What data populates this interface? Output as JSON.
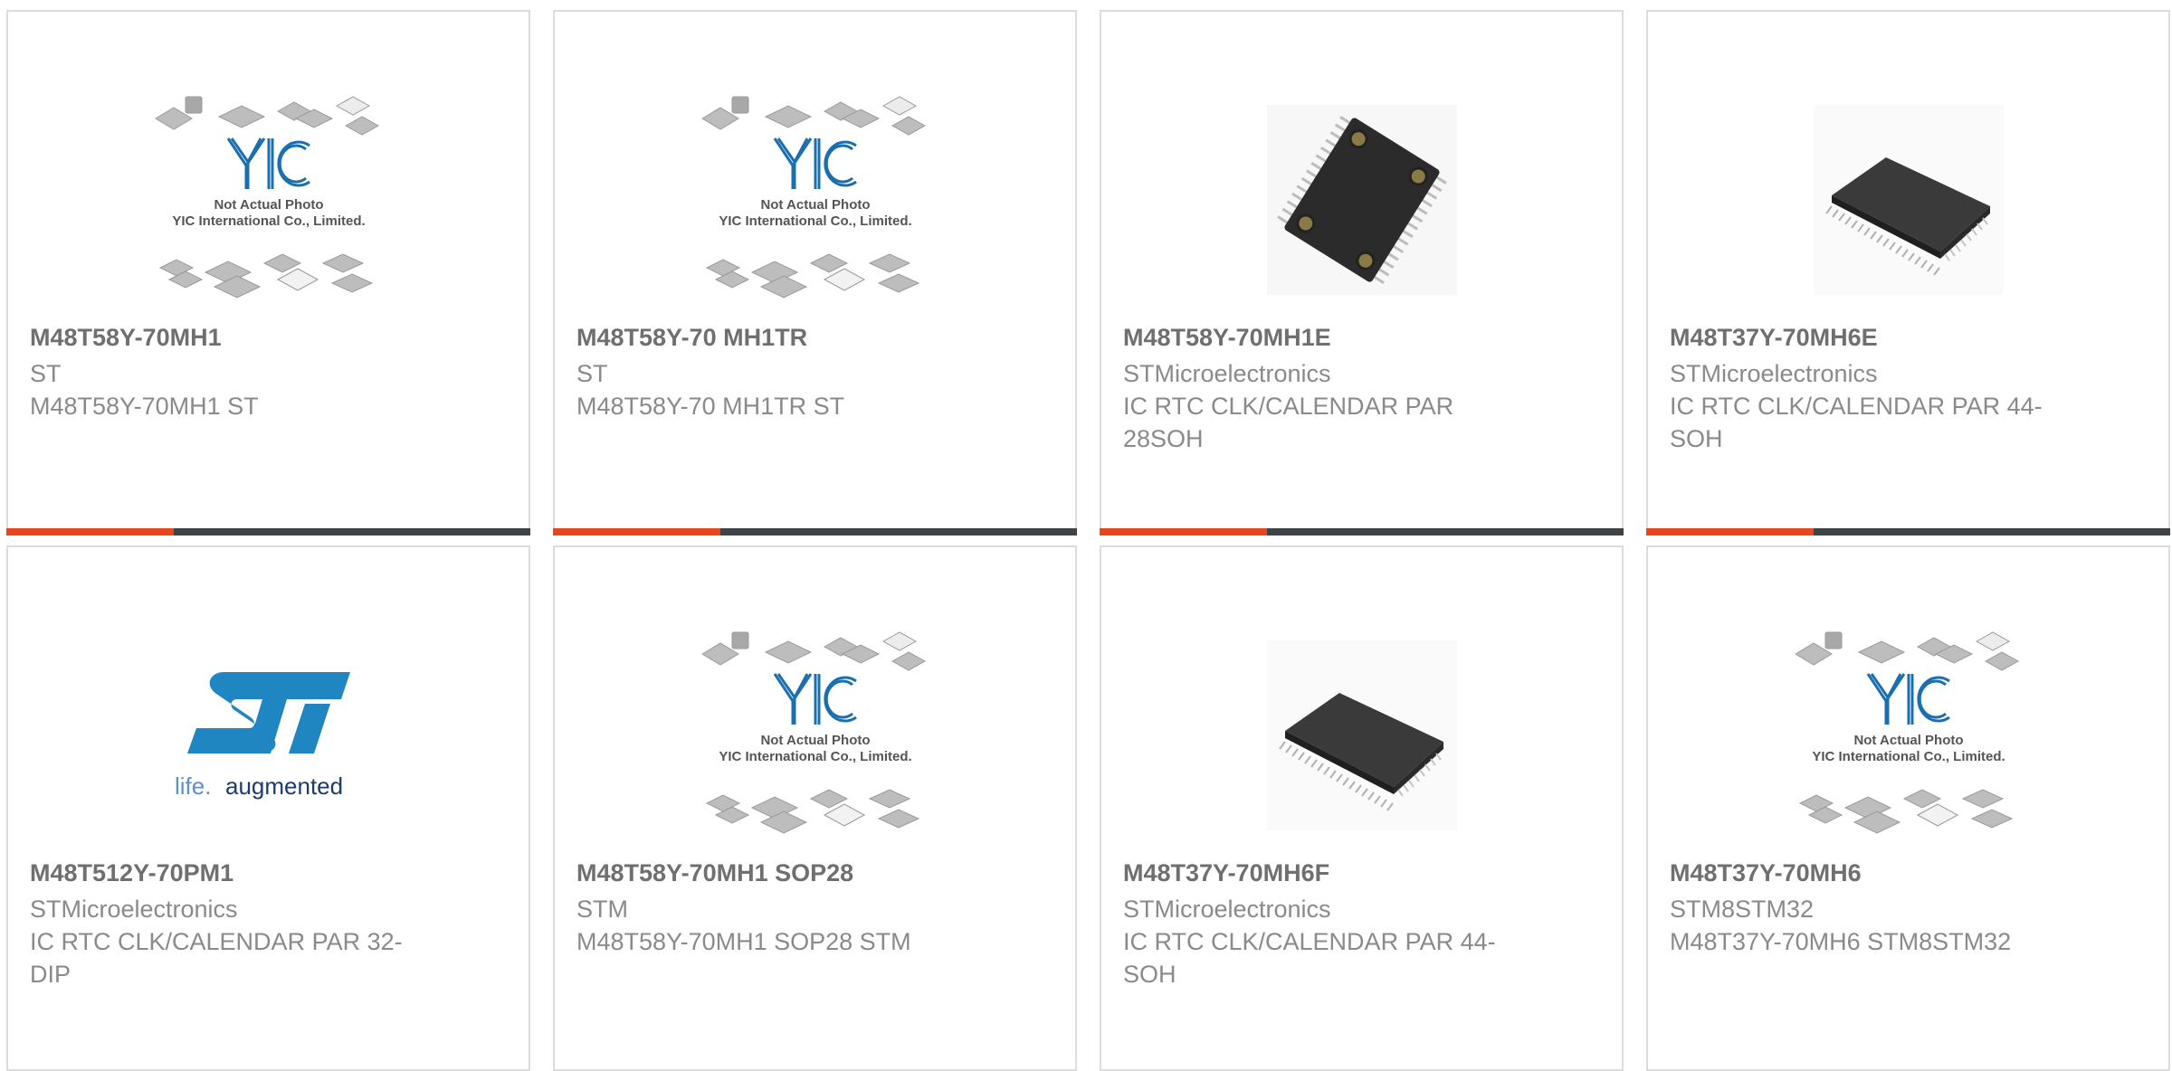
{
  "colors": {
    "accent": "#e8461c",
    "bar_dark": "#404345",
    "yic_blue": "#1a6fb0",
    "st_blue": "#1f86c2"
  },
  "products": [
    {
      "part_number": "M48T58Y-70MH1",
      "manufacturer": "ST",
      "description": "M48T58Y-70MH1 ST",
      "image": "yic-placeholder-image",
      "image_text": {
        "line1": "Not Actual Photo",
        "line2": "YIC International Co., Limited."
      }
    },
    {
      "part_number": "M48T58Y-70 MH1TR",
      "manufacturer": "ST",
      "description": "M48T58Y-70 MH1TR ST",
      "image": "yic-placeholder-image",
      "image_text": {
        "line1": "Not Actual Photo",
        "line2": "YIC International Co., Limited."
      }
    },
    {
      "part_number": "M48T58Y-70MH1E",
      "manufacturer": "STMicroelectronics",
      "description": "IC RTC CLK/CALENDAR PAR 28SOH",
      "image": "snaphat-chip-image"
    },
    {
      "part_number": "M48T37Y-70MH6E",
      "manufacturer": "STMicroelectronics",
      "description": "IC RTC CLK/CALENDAR PAR 44-SOH",
      "image": "soic-chip-image"
    },
    {
      "part_number": "M48T512Y-70PM1",
      "manufacturer": "STMicroelectronics",
      "description": "IC RTC CLK/CALENDAR PAR 32-DIP",
      "image": "st-logo-image",
      "image_text": {
        "tagline_a": "life.",
        "tagline_b": "augmented"
      }
    },
    {
      "part_number": "M48T58Y-70MH1 SOP28",
      "manufacturer": "STM",
      "description": "M48T58Y-70MH1 SOP28 STM",
      "image": "yic-placeholder-image",
      "image_text": {
        "line1": "Not Actual Photo",
        "line2": "YIC International Co., Limited."
      }
    },
    {
      "part_number": "M48T37Y-70MH6F",
      "manufacturer": "STMicroelectronics",
      "description": "IC RTC CLK/CALENDAR PAR 44-SOH",
      "image": "soic-chip-image"
    },
    {
      "part_number": "M48T37Y-70MH6",
      "manufacturer": "STM8STM32",
      "description": "M48T37Y-70MH6 STM8STM32",
      "image": "yic-placeholder-image",
      "image_text": {
        "line1": "Not Actual Photo",
        "line2": "YIC International Co., Limited."
      }
    }
  ]
}
